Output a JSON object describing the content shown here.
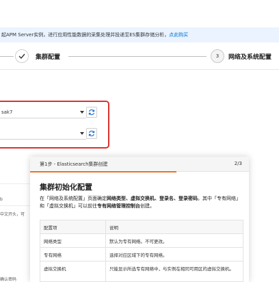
{
  "notice": {
    "text": "起APM Server实例，进行应用性能数据的采集处理并投递至ES集群存储分析，",
    "link": "点此购买"
  },
  "steps": {
    "step2_label": "集群配置",
    "step3_number": "3",
    "step3_label": "网络及系统配置"
  },
  "form": {
    "select1_value": "sak7",
    "select2_value": ""
  },
  "background": {
    "text1": "b",
    "text2": "中文开头，可",
    "text3": "确认密码"
  },
  "tour": {
    "header_title": "第1步 - Elasticsearch集群创建",
    "page": "2/3",
    "progress_pct": 67,
    "heading": "集群初始化配置",
    "body": {
      "p1": "在「网络及系统配置」页面确定",
      "p1_bold": "网络类型、虚拟交换机、登录名、登录密码",
      "p2": "。其中「专有网络」和「虚拟交换机」可以前往",
      "p2_bold": "专有网络管理控制台",
      "p3": "创建。"
    },
    "table": {
      "headers": [
        "配置项",
        "说明"
      ],
      "rows": [
        [
          "网络类型",
          "默认为专有网络。不可更改。"
        ],
        [
          "专有网络",
          "选择对应区域下的专有网络。"
        ],
        [
          "虚拟交换机",
          "只能显示所选专有网络中，与实例在相同可用区的虚拟交换机。"
        ]
      ]
    }
  }
}
